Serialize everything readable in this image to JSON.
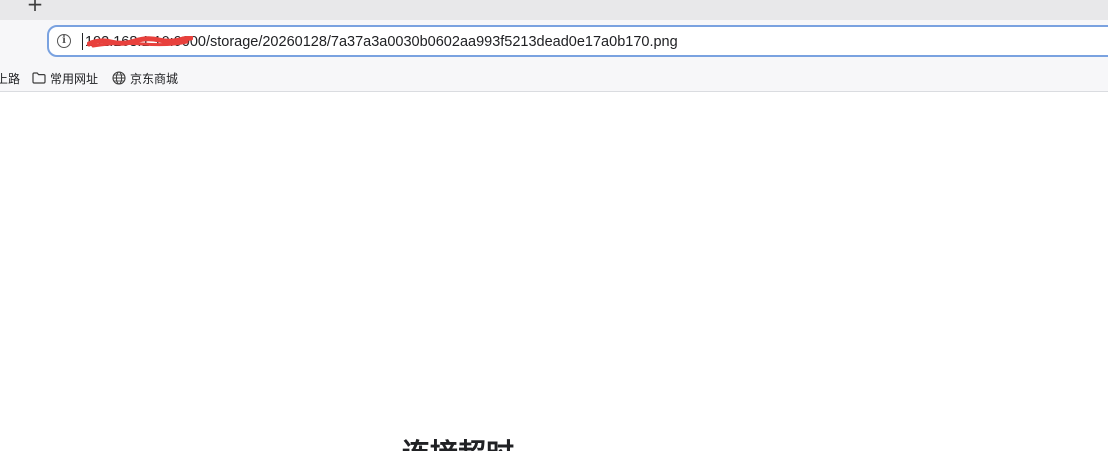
{
  "tabstrip": {
    "new_tab_glyph": "+"
  },
  "address_bar": {
    "info_icon_glyph": "i",
    "url": "192.168.1.10:9000/storage/20260128/7a37a3a0030b0602aa993f5213dead0e17a0b170.png",
    "redaction_color": "#e8403c",
    "focus_border_color": "#7aa2e0"
  },
  "bookmarks": {
    "items": [
      {
        "label": "上路",
        "icon": "none"
      },
      {
        "label": "常用网址",
        "icon": "folder-icon"
      },
      {
        "label": "京东商城",
        "icon": "globe-icon"
      }
    ]
  },
  "page": {
    "error_title": "连接超时"
  }
}
